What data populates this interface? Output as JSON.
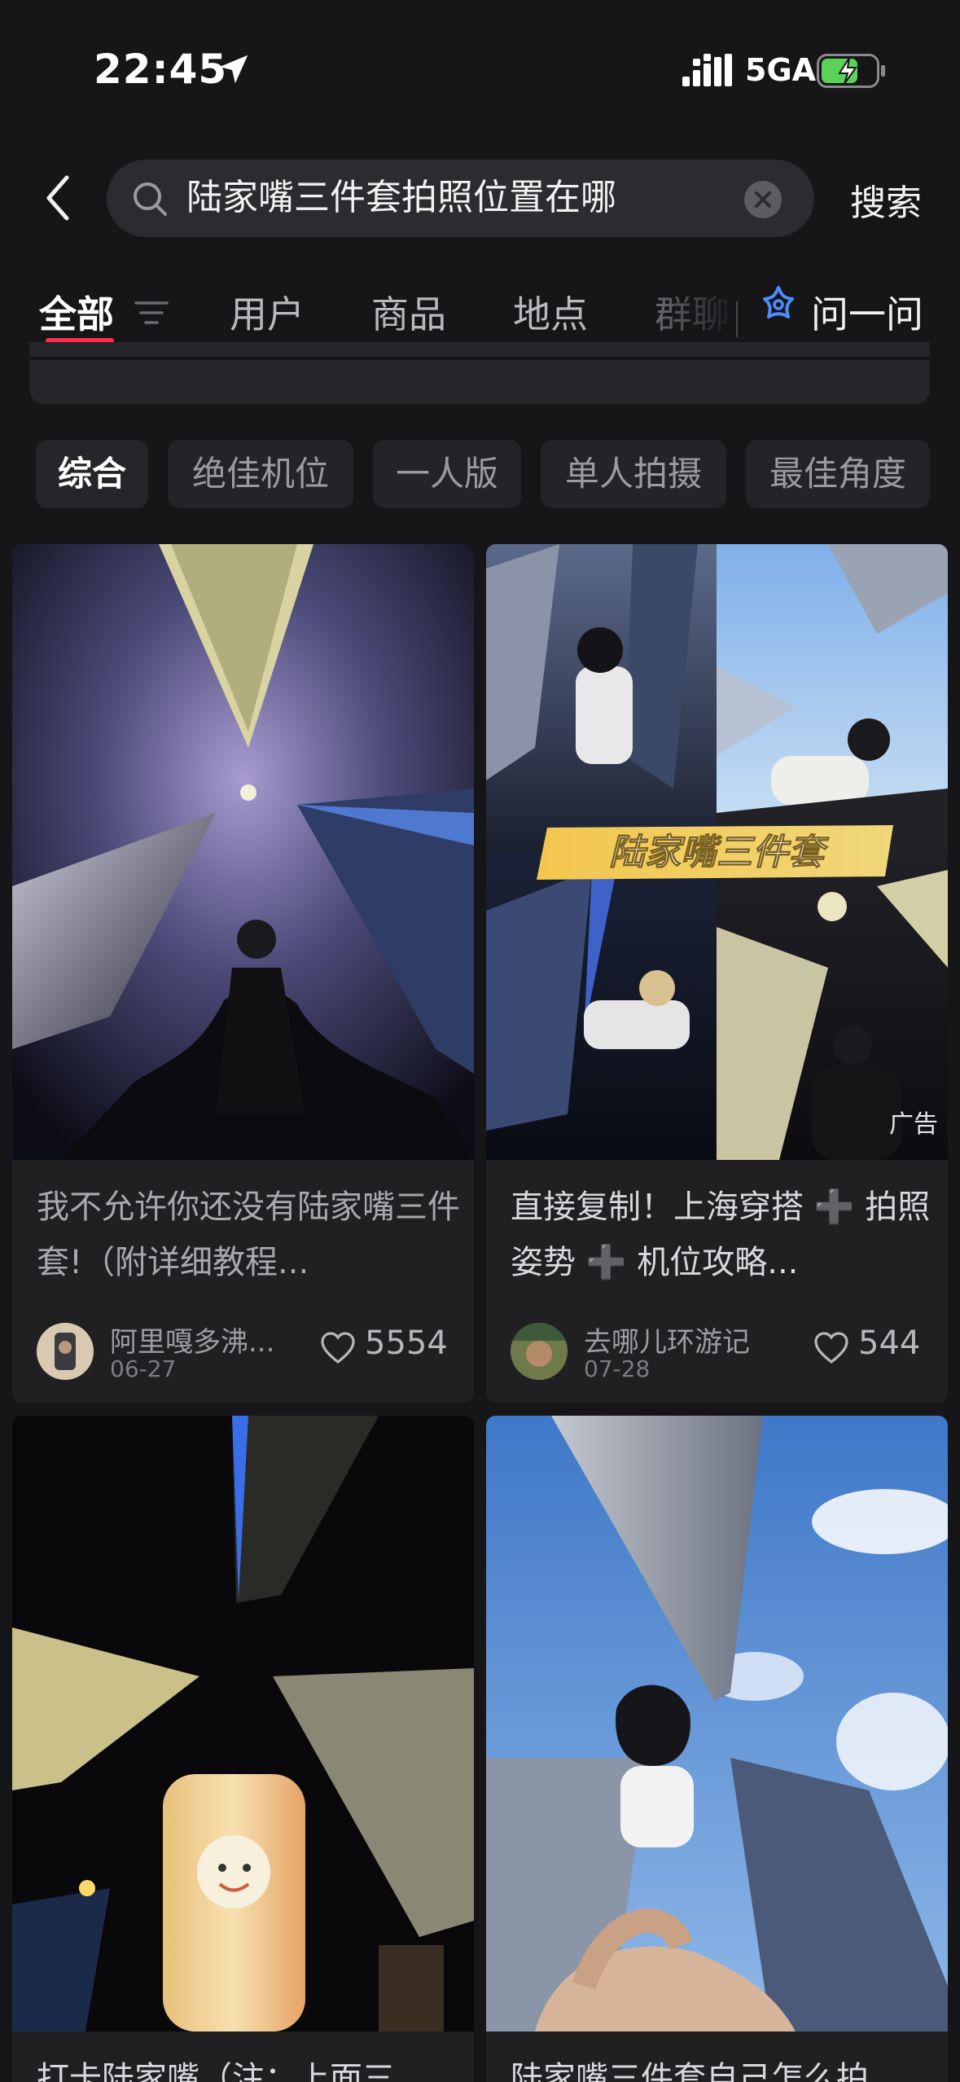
{
  "status_bar": {
    "time": "22:45",
    "network": "5GA",
    "icons": [
      "location-arrow-icon",
      "signal-icon",
      "battery-charging-icon"
    ]
  },
  "search": {
    "query": "陆家嘴三件套拍照位置在哪",
    "submit_label": "搜索",
    "icons": [
      "back-icon",
      "search-icon",
      "clear-icon"
    ]
  },
  "tabs": {
    "items": [
      {
        "label": "全部",
        "active": true
      },
      {
        "label": "用户",
        "active": false
      },
      {
        "label": "商品",
        "active": false
      },
      {
        "label": "地点",
        "active": false
      },
      {
        "label": "群聊",
        "active": false
      }
    ],
    "ask_label": "问一问",
    "accent_color": "#ff2e4d"
  },
  "chips": [
    "综合",
    "绝佳机位",
    "一人版",
    "单人拍摄",
    "最佳角度"
  ],
  "feed": {
    "cards": [
      {
        "title": "我不允许你还没有陆家嘴三件套!（附详细教程...",
        "author": "阿里嘎多沸...",
        "date": "06-27",
        "likes": "5554"
      },
      {
        "title": "直接复制！上海穿搭 ➕ 拍照姿势 ➕ 机位攻略...",
        "author": "去哪儿环游记",
        "date": "07-28",
        "likes": "544",
        "overlay_text": "陆家嘴三件套",
        "ad_label": "广告"
      },
      {
        "title": "打卡陆家嘴（注：上面三"
      },
      {
        "title": "陆家嘴三件套自己怎么拍"
      }
    ]
  }
}
